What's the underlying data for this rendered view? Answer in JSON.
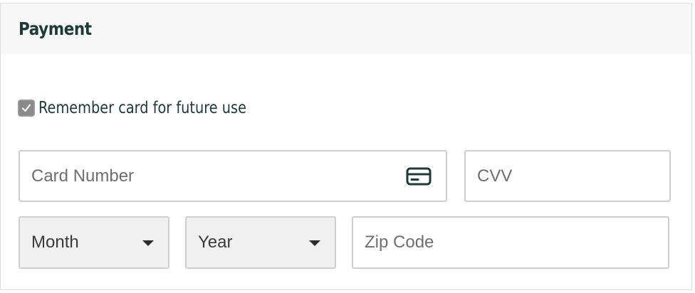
{
  "payment": {
    "title": "Payment",
    "remember": {
      "label": "Remember card for future use",
      "checked": true
    },
    "card_number": {
      "placeholder": "Card Number",
      "value": "",
      "icon": "credit-card-icon"
    },
    "cvv": {
      "placeholder": "CVV",
      "value": ""
    },
    "month": {
      "selected": "Month"
    },
    "year": {
      "selected": "Year"
    },
    "zip": {
      "placeholder": "Zip Code",
      "value": ""
    }
  },
  "colors": {
    "heading": "#1b3b37",
    "header_bg": "#f7f7f7",
    "border": "#cfcfcf",
    "select_bg": "#f0f0f0",
    "placeholder": "#6f6f6f"
  }
}
